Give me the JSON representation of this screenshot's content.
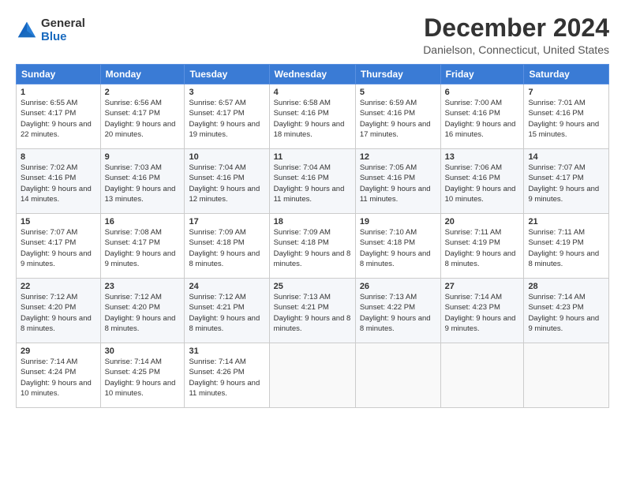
{
  "logo": {
    "general": "General",
    "blue": "Blue"
  },
  "title": "December 2024",
  "location": "Danielson, Connecticut, United States",
  "days_header": [
    "Sunday",
    "Monday",
    "Tuesday",
    "Wednesday",
    "Thursday",
    "Friday",
    "Saturday"
  ],
  "weeks": [
    [
      {
        "num": "1",
        "sunrise": "6:55 AM",
        "sunset": "4:17 PM",
        "daylight": "9 hours and 22 minutes."
      },
      {
        "num": "2",
        "sunrise": "6:56 AM",
        "sunset": "4:17 PM",
        "daylight": "9 hours and 20 minutes."
      },
      {
        "num": "3",
        "sunrise": "6:57 AM",
        "sunset": "4:17 PM",
        "daylight": "9 hours and 19 minutes."
      },
      {
        "num": "4",
        "sunrise": "6:58 AM",
        "sunset": "4:16 PM",
        "daylight": "9 hours and 18 minutes."
      },
      {
        "num": "5",
        "sunrise": "6:59 AM",
        "sunset": "4:16 PM",
        "daylight": "9 hours and 17 minutes."
      },
      {
        "num": "6",
        "sunrise": "7:00 AM",
        "sunset": "4:16 PM",
        "daylight": "9 hours and 16 minutes."
      },
      {
        "num": "7",
        "sunrise": "7:01 AM",
        "sunset": "4:16 PM",
        "daylight": "9 hours and 15 minutes."
      }
    ],
    [
      {
        "num": "8",
        "sunrise": "7:02 AM",
        "sunset": "4:16 PM",
        "daylight": "9 hours and 14 minutes."
      },
      {
        "num": "9",
        "sunrise": "7:03 AM",
        "sunset": "4:16 PM",
        "daylight": "9 hours and 13 minutes."
      },
      {
        "num": "10",
        "sunrise": "7:04 AM",
        "sunset": "4:16 PM",
        "daylight": "9 hours and 12 minutes."
      },
      {
        "num": "11",
        "sunrise": "7:04 AM",
        "sunset": "4:16 PM",
        "daylight": "9 hours and 11 minutes."
      },
      {
        "num": "12",
        "sunrise": "7:05 AM",
        "sunset": "4:16 PM",
        "daylight": "9 hours and 11 minutes."
      },
      {
        "num": "13",
        "sunrise": "7:06 AM",
        "sunset": "4:16 PM",
        "daylight": "9 hours and 10 minutes."
      },
      {
        "num": "14",
        "sunrise": "7:07 AM",
        "sunset": "4:17 PM",
        "daylight": "9 hours and 9 minutes."
      }
    ],
    [
      {
        "num": "15",
        "sunrise": "7:07 AM",
        "sunset": "4:17 PM",
        "daylight": "9 hours and 9 minutes."
      },
      {
        "num": "16",
        "sunrise": "7:08 AM",
        "sunset": "4:17 PM",
        "daylight": "9 hours and 9 minutes."
      },
      {
        "num": "17",
        "sunrise": "7:09 AM",
        "sunset": "4:18 PM",
        "daylight": "9 hours and 8 minutes."
      },
      {
        "num": "18",
        "sunrise": "7:09 AM",
        "sunset": "4:18 PM",
        "daylight": "9 hours and 8 minutes."
      },
      {
        "num": "19",
        "sunrise": "7:10 AM",
        "sunset": "4:18 PM",
        "daylight": "9 hours and 8 minutes."
      },
      {
        "num": "20",
        "sunrise": "7:11 AM",
        "sunset": "4:19 PM",
        "daylight": "9 hours and 8 minutes."
      },
      {
        "num": "21",
        "sunrise": "7:11 AM",
        "sunset": "4:19 PM",
        "daylight": "9 hours and 8 minutes."
      }
    ],
    [
      {
        "num": "22",
        "sunrise": "7:12 AM",
        "sunset": "4:20 PM",
        "daylight": "9 hours and 8 minutes."
      },
      {
        "num": "23",
        "sunrise": "7:12 AM",
        "sunset": "4:20 PM",
        "daylight": "9 hours and 8 minutes."
      },
      {
        "num": "24",
        "sunrise": "7:12 AM",
        "sunset": "4:21 PM",
        "daylight": "9 hours and 8 minutes."
      },
      {
        "num": "25",
        "sunrise": "7:13 AM",
        "sunset": "4:21 PM",
        "daylight": "9 hours and 8 minutes."
      },
      {
        "num": "26",
        "sunrise": "7:13 AM",
        "sunset": "4:22 PM",
        "daylight": "9 hours and 8 minutes."
      },
      {
        "num": "27",
        "sunrise": "7:14 AM",
        "sunset": "4:23 PM",
        "daylight": "9 hours and 9 minutes."
      },
      {
        "num": "28",
        "sunrise": "7:14 AM",
        "sunset": "4:23 PM",
        "daylight": "9 hours and 9 minutes."
      }
    ],
    [
      {
        "num": "29",
        "sunrise": "7:14 AM",
        "sunset": "4:24 PM",
        "daylight": "9 hours and 10 minutes."
      },
      {
        "num": "30",
        "sunrise": "7:14 AM",
        "sunset": "4:25 PM",
        "daylight": "9 hours and 10 minutes."
      },
      {
        "num": "31",
        "sunrise": "7:14 AM",
        "sunset": "4:26 PM",
        "daylight": "9 hours and 11 minutes."
      },
      null,
      null,
      null,
      null
    ]
  ]
}
